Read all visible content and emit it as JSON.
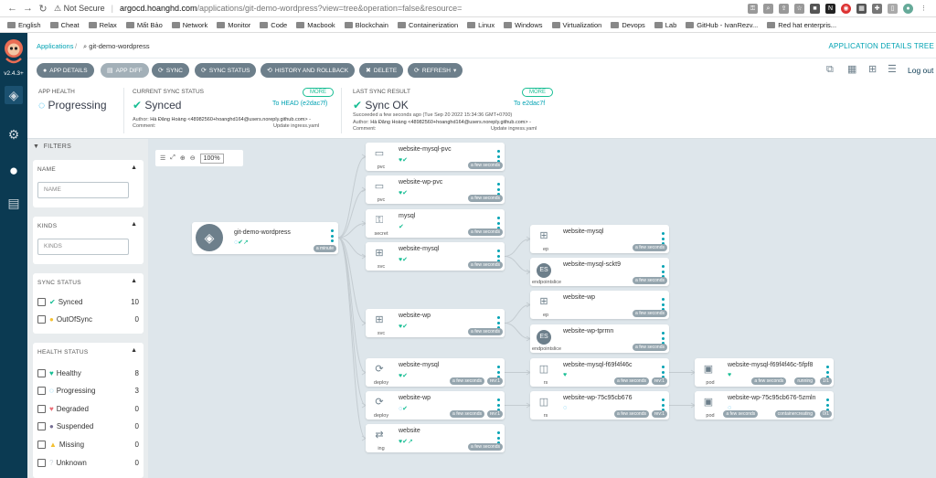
{
  "browser": {
    "security_label": "Not Secure",
    "url_host": "argocd.hoanghd.com",
    "url_path": "/applications/git-demo-wordpress?view=tree&operation=false&resource=",
    "bookmarks": [
      "English",
      "Cheat",
      "Relax",
      "Mất Bảo",
      "Network",
      "Monitor",
      "Code",
      "Macbook",
      "Blockchain",
      "Containerization",
      "Linux",
      "Windows",
      "Virtualization",
      "Devops",
      "Lab",
      "GitHub - IvanRezv...",
      "Red hat enterpris..."
    ]
  },
  "nav": {
    "version": "v2.4.3+"
  },
  "breadcrumb": {
    "root": "Applications",
    "current": "git-demo-wordpress"
  },
  "page_title": "APPLICATION DETAILS TREE",
  "logout": "Log out",
  "toolbar": {
    "app_details": "APP DETAILS",
    "app_diff": "APP DIFF",
    "sync": "SYNC",
    "sync_status": "SYNC STATUS",
    "history": "HISTORY AND ROLLBACK",
    "delete": "DELETE",
    "refresh": "REFRESH"
  },
  "status": {
    "app_health_label": "APP HEALTH",
    "app_health_value": "Progressing",
    "sync_status_label": "CURRENT SYNC STATUS",
    "sync_status_value": "Synced",
    "sync_to": "To HEAD (e2dac7f)",
    "more": "MORE",
    "author_label": "Author:",
    "author_value": "Hà Đăng Hoàng <48982560+hoanghd164@users.noreply.github.com> -",
    "comment_label": "Comment:",
    "comment_value": "Update ingress.yaml",
    "last_sync_label": "LAST SYNC RESULT",
    "last_sync_value": "Sync OK",
    "last_sync_to": "To e2dac7f",
    "succeeded": "Succeeded a few seconds ago (Tue Sep 20 2022 15:34:36 GMT+0700)",
    "colors": {
      "healthy": "#18be94",
      "progressing": "#0dadea"
    }
  },
  "filters": {
    "title": "FILTERS",
    "name_header": "NAME",
    "name_placeholder": "NAME",
    "kinds_header": "KINDS",
    "kinds_placeholder": "KINDS",
    "sync_header": "SYNC STATUS",
    "sync_items": [
      {
        "label": "Synced",
        "count": "10"
      },
      {
        "label": "OutOfSync",
        "count": "0"
      }
    ],
    "health_header": "HEALTH STATUS",
    "health_items": [
      {
        "label": "Healthy",
        "count": "8"
      },
      {
        "label": "Progressing",
        "count": "3"
      },
      {
        "label": "Degraded",
        "count": "0"
      },
      {
        "label": "Suspended",
        "count": "0"
      },
      {
        "label": "Missing",
        "count": "0"
      },
      {
        "label": "Unknown",
        "count": "0"
      }
    ]
  },
  "zoom": {
    "level": "100%"
  },
  "tree": {
    "app": {
      "name": "git-demo-wordpress",
      "age": "a minute"
    },
    "nodes": [
      {
        "name": "website-mysql-pvc",
        "kind": "pvc",
        "age": "a few seconds",
        "icon": "disk-icon"
      },
      {
        "name": "website-wp-pvc",
        "kind": "pvc",
        "age": "a few seconds",
        "icon": "disk-icon"
      },
      {
        "name": "mysql",
        "kind": "secret",
        "age": "a few seconds",
        "icon": "secret-icon"
      },
      {
        "name": "website-mysql",
        "kind": "svc",
        "age": "a few seconds",
        "icon": "network-icon"
      },
      {
        "name": "website-wp",
        "kind": "svc",
        "age": "a few seconds",
        "icon": "network-icon"
      },
      {
        "name": "website-mysql",
        "kind": "deploy",
        "age": "a few seconds",
        "rev": "rev:1",
        "icon": "deploy-icon"
      },
      {
        "name": "website-wp",
        "kind": "deploy",
        "age": "a few seconds",
        "rev": "rev:1",
        "icon": "deploy-icon"
      },
      {
        "name": "website",
        "kind": "ing",
        "age": "a few seconds",
        "icon": "ingress-icon"
      },
      {
        "name": "website-mysql",
        "kind": "ep",
        "age": "a few seconds",
        "icon": "network-icon"
      },
      {
        "name": "website-mysql-sckt9",
        "kind": "endpointslice",
        "age": "a few seconds",
        "icon": "ES"
      },
      {
        "name": "website-wp",
        "kind": "ep",
        "age": "a few seconds",
        "icon": "network-icon"
      },
      {
        "name": "website-wp-tprmn",
        "kind": "endpointslice",
        "age": "a few seconds",
        "icon": "ES"
      },
      {
        "name": "website-mysql-f69f4f46c",
        "kind": "rs",
        "age": "a few seconds",
        "rev": "rev:1",
        "icon": "layers-icon"
      },
      {
        "name": "website-wp-75c95cb676",
        "kind": "rs",
        "age": "a few seconds",
        "rev": "rev:1",
        "icon": "layers-icon"
      },
      {
        "name": "website-mysql-f69f4f46c-5fpf8",
        "kind": "pod",
        "age": "a few seconds",
        "state": "running",
        "ready": "1/1",
        "icon": "cube-icon"
      },
      {
        "name": "website-wp-75c95cb676-5zmln",
        "kind": "pod",
        "age": "a few seconds",
        "state": "containercreating",
        "ready": "0/1",
        "icon": "cube-icon"
      }
    ]
  }
}
